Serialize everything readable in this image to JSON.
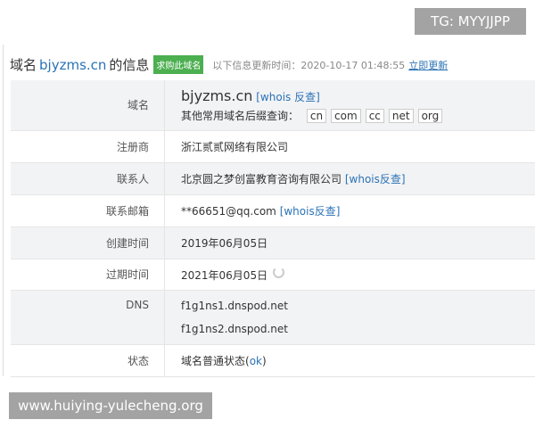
{
  "header": {
    "prefix": "域名",
    "domain": "bjyzms.cn",
    "suffix": "的信息",
    "buy_label": "求购此域名",
    "update_text": "以下信息更新时间：2020-10-17 01:48:55",
    "update_link": "立即更新"
  },
  "rows": {
    "domain": {
      "label": "域名",
      "value": "bjyzms.cn",
      "whois": "[whois 反查]",
      "suffix_label": "其他常用域名后缀查询：",
      "suffixes": [
        "cn",
        "com",
        "cc",
        "net",
        "org"
      ]
    },
    "registrar": {
      "label": "注册商",
      "value": "浙江贰贰网络有限公司"
    },
    "contact": {
      "label": "联系人",
      "value": "北京圆之梦创富教育咨询有限公司",
      "whois": "[whois反查]"
    },
    "email": {
      "label": "联系邮箱",
      "value": "**66651@qq.com",
      "whois": "[whois反查]"
    },
    "created": {
      "label": "创建时间",
      "value": "2019年06月05日"
    },
    "expires": {
      "label": "过期时间",
      "value": "2021年06月05日"
    },
    "dns": {
      "label": "DNS",
      "values": [
        "f1g1ns1.dnspod.net",
        "f1g1ns2.dnspod.net"
      ]
    },
    "status": {
      "label": "状态",
      "value": "域名普通状态(",
      "link": "ok",
      "close": ")"
    }
  },
  "watermarks": {
    "top": "TG: MYYJJPP",
    "bottom": "www.huiying-yulecheng.org"
  }
}
